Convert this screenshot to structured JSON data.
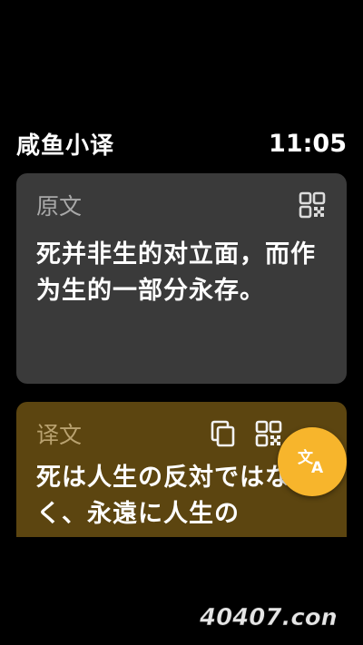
{
  "header": {
    "app_title": "咸鱼小译",
    "time": "11:05"
  },
  "source_card": {
    "label": "原文",
    "text": "死并非生的对立面，而作为生的一部分永存。",
    "icon": "qr-code-icon",
    "background": "#3a3a3a"
  },
  "target_card": {
    "label": "译文",
    "text": "死は人生の反対ではなく、永遠に人生の",
    "icons": [
      "copy-icon",
      "qr-code-icon"
    ],
    "background": "#5c4510"
  },
  "fab": {
    "icon": "translate-icon",
    "color": "#f7b52c"
  },
  "watermark": {
    "text": "40407.com"
  }
}
